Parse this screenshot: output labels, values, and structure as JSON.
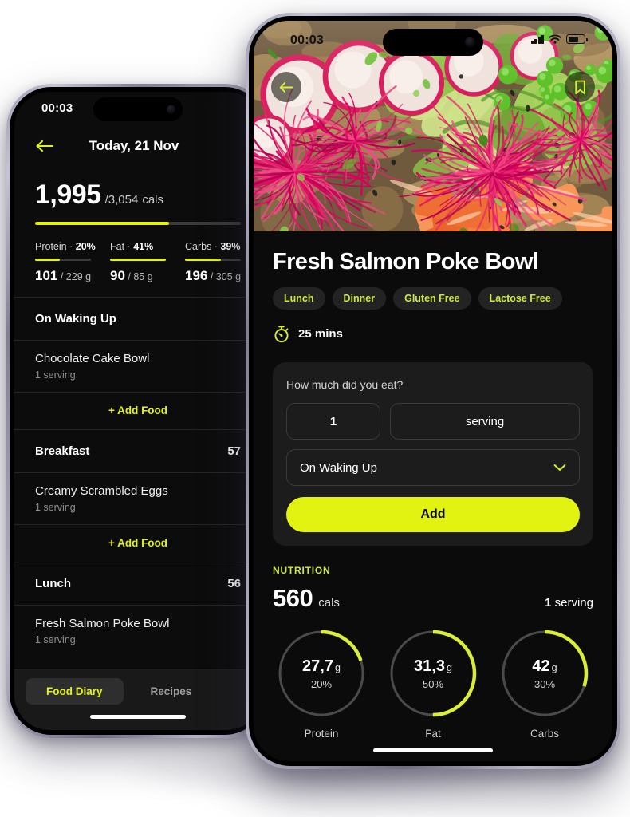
{
  "accent": "#E2F312",
  "left_phone": {
    "status": {
      "time": "00:03"
    },
    "nav": {
      "back_icon": "arrow-left-icon",
      "title": "Today, 21 Nov"
    },
    "calories": {
      "consumed": "1,995",
      "separator": "/",
      "goal": "3,054",
      "unit": "cals",
      "progress_pct": 65
    },
    "macros": [
      {
        "name": "Protein",
        "dot": "·",
        "percent": "20%",
        "value": "101",
        "sep": "/",
        "goal": "229 g",
        "bar_pct": 44
      },
      {
        "name": "Fat",
        "dot": "·",
        "percent": "41%",
        "value": "90",
        "sep": "/",
        "goal": "85 g",
        "bar_pct": 100
      },
      {
        "name": "Carbs",
        "dot": "·",
        "percent": "39%",
        "value": "196",
        "sep": "/",
        "goal": "305 g",
        "bar_pct": 64
      }
    ],
    "sections": [
      {
        "title": "On Waking Up",
        "kcal": "",
        "items": [
          {
            "name": "Chocolate Cake Bowl",
            "sub": "1 serving"
          }
        ],
        "add_label": "+ Add Food"
      },
      {
        "title": "Breakfast",
        "kcal": "57",
        "items": [
          {
            "name": "Creamy Scrambled Eggs",
            "sub": "1 serving"
          }
        ],
        "add_label": "+ Add Food"
      },
      {
        "title": "Lunch",
        "kcal": "56",
        "items": [
          {
            "name": "Fresh Salmon Poke Bowl",
            "sub": "1 serving"
          }
        ],
        "add_label": ""
      }
    ],
    "tabs": [
      {
        "label": "Food Diary",
        "active": true
      },
      {
        "label": "Recipes",
        "active": false
      }
    ]
  },
  "right_phone": {
    "status": {
      "time": "00:03"
    },
    "hero": {
      "back_icon": "arrow-left-icon",
      "bookmark_icon": "bookmark-icon",
      "image_alt": "fresh salmon poke bowl with radish avocado and beet sprouts"
    },
    "recipe": {
      "title": "Fresh Salmon Poke Bowl",
      "tags": [
        "Lunch",
        "Dinner",
        "Gluten Free",
        "Lactose Free"
      ],
      "time_icon": "stopwatch-icon",
      "time": "25 mins"
    },
    "log_card": {
      "question": "How much did you eat?",
      "quantity": "1",
      "unit": "serving",
      "meal": "On Waking Up",
      "meal_chevron_icon": "chevron-down-icon",
      "add_button": "Add"
    },
    "nutrition": {
      "label": "NUTRITION",
      "calories": "560",
      "calories_unit": "cals",
      "servings_value": "1",
      "servings_unit": "serving",
      "rings": [
        {
          "label": "Protein",
          "grams": "27,7",
          "unit": "g",
          "percent": "20%",
          "pct": 20
        },
        {
          "label": "Fat",
          "grams": "31,3",
          "unit": "g",
          "percent": "50%",
          "pct": 50
        },
        {
          "label": "Carbs",
          "grams": "42",
          "unit": "g",
          "percent": "30%",
          "pct": 30
        }
      ]
    }
  }
}
